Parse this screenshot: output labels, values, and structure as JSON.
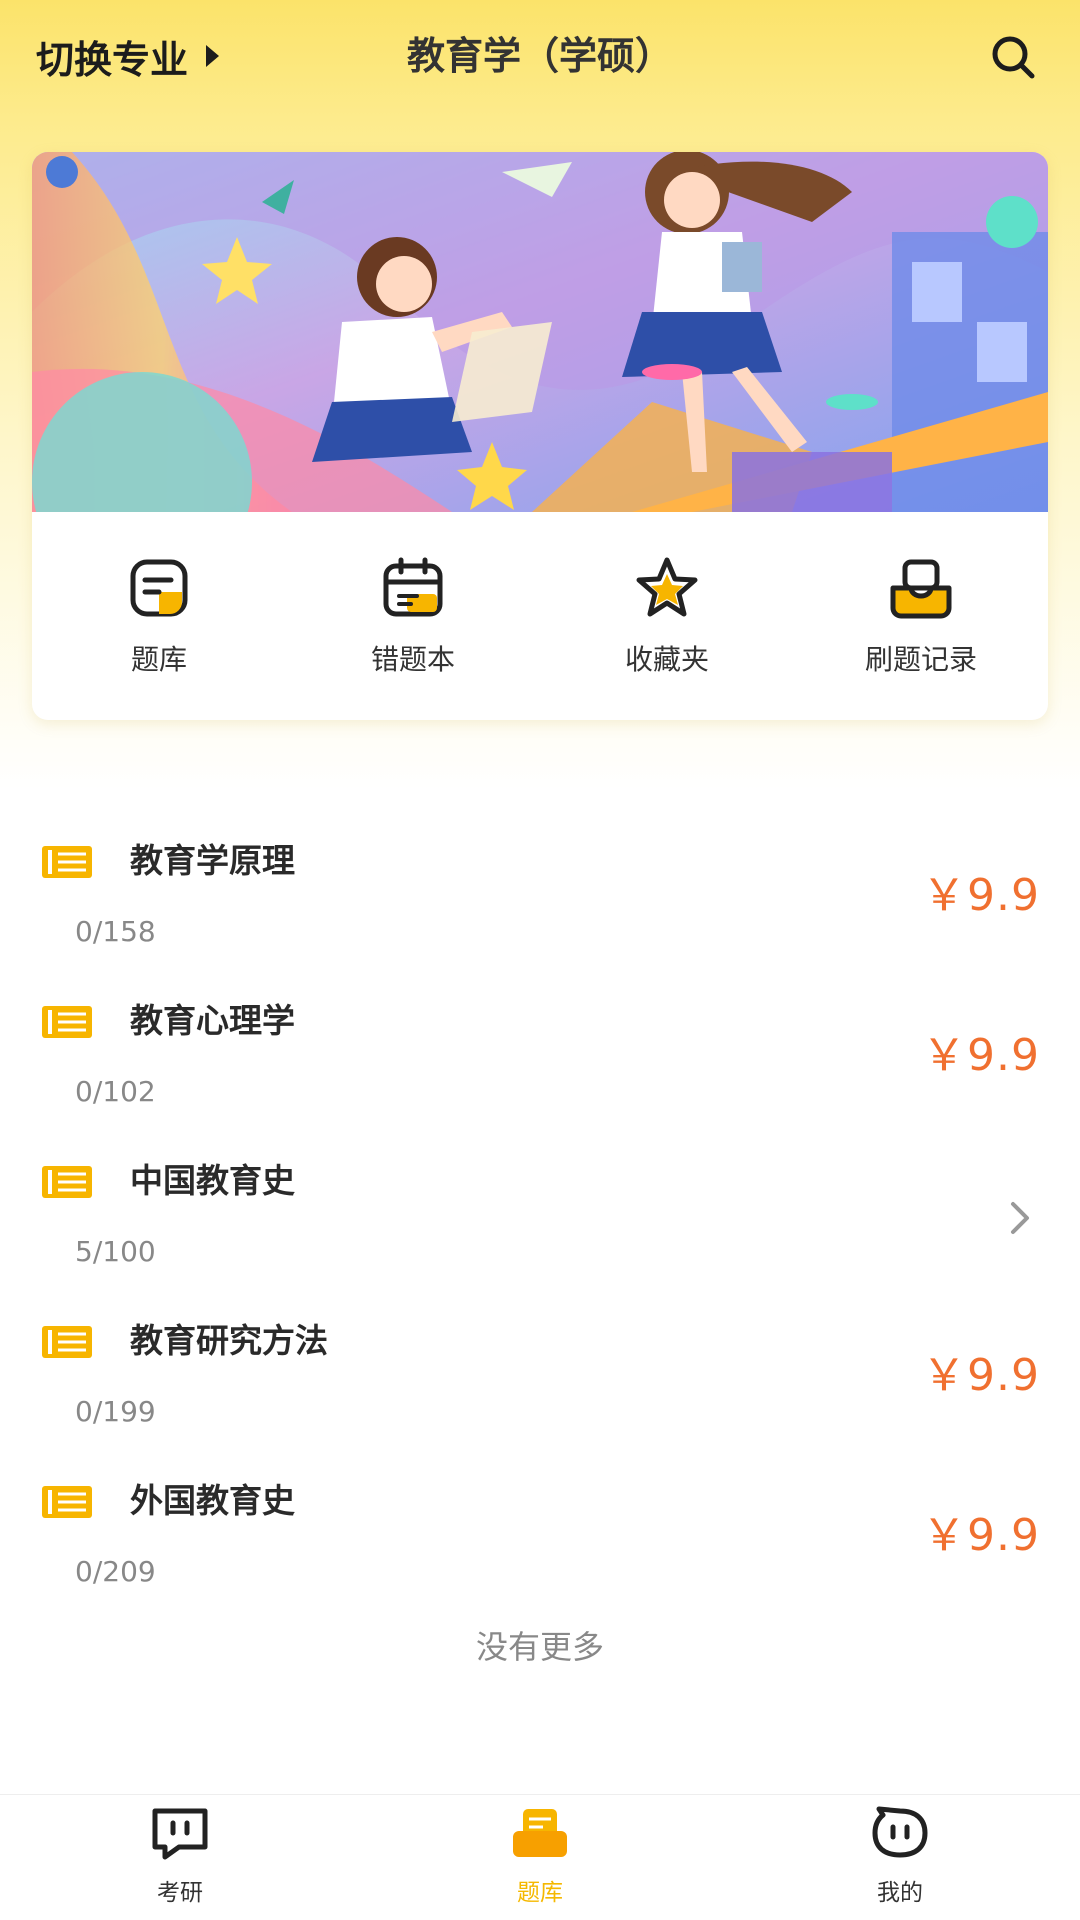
{
  "header": {
    "switch_label": "切换专业",
    "title": "教育学（学硕）",
    "search_icon": "search-icon"
  },
  "quick_actions": [
    {
      "label": "题库",
      "icon": "question-bank-icon"
    },
    {
      "label": "错题本",
      "icon": "wrong-book-icon"
    },
    {
      "label": "收藏夹",
      "icon": "star-icon"
    },
    {
      "label": "刷题记录",
      "icon": "inbox-record-icon"
    }
  ],
  "subjects": [
    {
      "name": "教育学原理",
      "progress": "0/158",
      "price": "￥9.9"
    },
    {
      "name": "教育心理学",
      "progress": "0/102",
      "price": "￥9.9"
    },
    {
      "name": "中国教育史",
      "progress": "5/100",
      "price": ""
    },
    {
      "name": "教育研究方法",
      "progress": "0/199",
      "price": "￥9.9"
    },
    {
      "name": "外国教育史",
      "progress": "0/209",
      "price": "￥9.9"
    }
  ],
  "footer_text": "没有更多",
  "tabs": [
    {
      "label": "考研",
      "icon": "chat-bubble-icon",
      "active": false
    },
    {
      "label": "题库",
      "icon": "question-bank-icon",
      "active": true
    },
    {
      "label": "我的",
      "icon": "face-icon",
      "active": false
    }
  ],
  "colors": {
    "accent": "#f5b800",
    "price": "#f07030",
    "header_yellow": "#fbe36a"
  }
}
